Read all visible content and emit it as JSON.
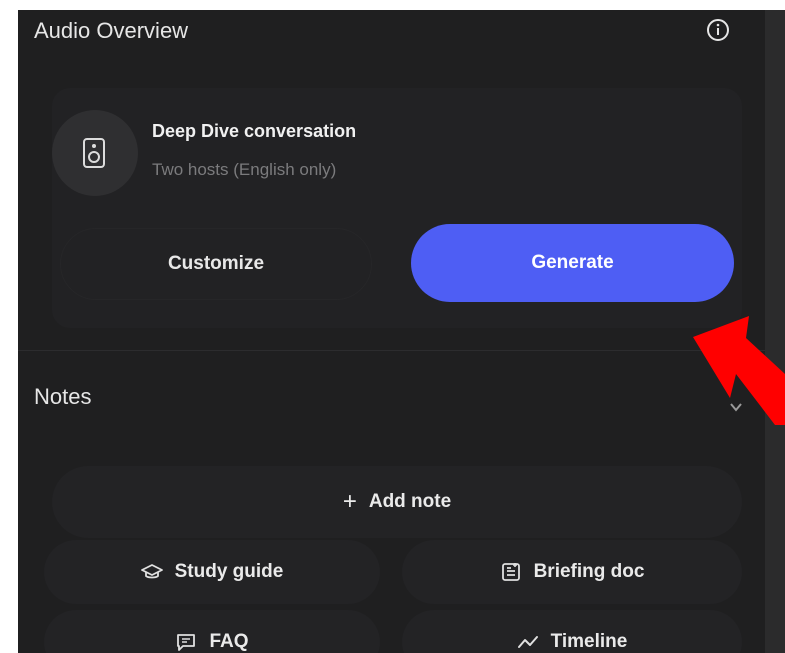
{
  "audio_overview": {
    "title": "Audio Overview",
    "info_icon": "info-icon",
    "card": {
      "icon": "speaker-icon",
      "title": "Deep Dive conversation",
      "subtitle": "Two hosts (English only)"
    },
    "customize_label": "Customize",
    "generate_label": "Generate"
  },
  "notes": {
    "title": "Notes",
    "add_note_label": "Add note",
    "actions": [
      {
        "label": "Study guide",
        "icon": "graduation-cap-icon"
      },
      {
        "label": "Briefing doc",
        "icon": "briefing-doc-icon"
      },
      {
        "label": "FAQ",
        "icon": "faq-icon"
      },
      {
        "label": "Timeline",
        "icon": "timeline-icon"
      }
    ]
  },
  "colors": {
    "panel_bg": "#1f1f20",
    "accent": "#4e5ef4",
    "annotation_arrow": "#ff0000"
  }
}
